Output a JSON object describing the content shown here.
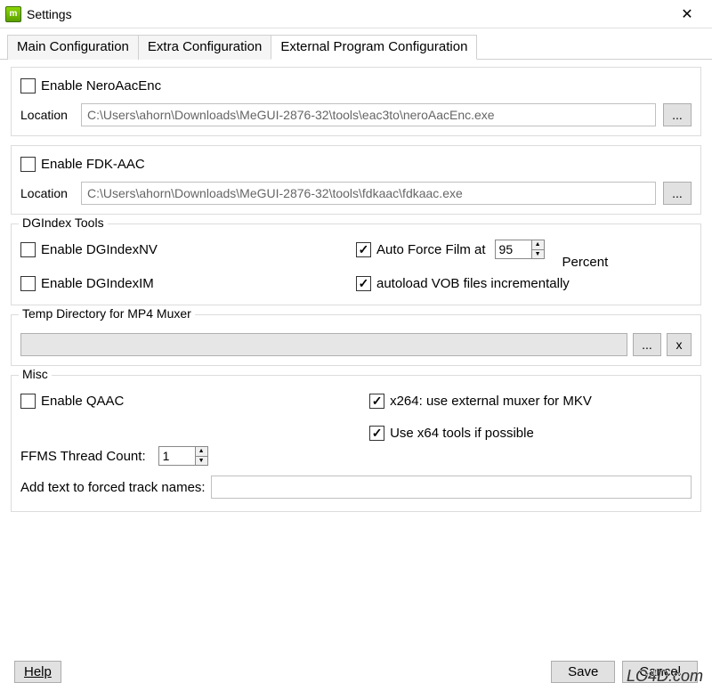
{
  "window": {
    "title": "Settings"
  },
  "tabs": {
    "main": "Main Configuration",
    "extra": "Extra Configuration",
    "external": "External Program Configuration"
  },
  "nero": {
    "enable_label": "Enable NeroAacEnc",
    "checked": false,
    "location_label": "Location",
    "path": "C:\\Users\\ahorn\\Downloads\\MeGUI-2876-32\\tools\\eac3to\\neroAacEnc.exe",
    "browse": "..."
  },
  "fdk": {
    "enable_label": "Enable FDK-AAC",
    "checked": false,
    "location_label": "Location",
    "path": "C:\\Users\\ahorn\\Downloads\\MeGUI-2876-32\\tools\\fdkaac\\fdkaac.exe",
    "browse": "..."
  },
  "dgindex": {
    "legend": "DGIndex Tools",
    "nv_label": "Enable DGIndexNV",
    "nv_checked": false,
    "im_label": "Enable DGIndexIM",
    "im_checked": false,
    "autoforce_label": "Auto Force Film at",
    "autoforce_checked": true,
    "autoforce_value": "95",
    "percent_label": "Percent",
    "autoload_label": "autoload VOB files incrementally",
    "autoload_checked": true
  },
  "tempdir": {
    "legend": "Temp Directory for MP4 Muxer",
    "value": "",
    "browse": "...",
    "clear": "x"
  },
  "misc": {
    "legend": "Misc",
    "qaac_label": "Enable QAAC",
    "qaac_checked": false,
    "x264_label": "x264: use external muxer for MKV",
    "x264_checked": true,
    "x64_label": "Use x64 tools if possible",
    "x64_checked": true,
    "ffms_label": "FFMS Thread Count:",
    "ffms_value": "1",
    "forced_label": "Add text to forced track names:",
    "forced_value": ""
  },
  "footer": {
    "help": "Help",
    "save": "Save",
    "cancel": "Cancel"
  },
  "watermark": "LO4D.com"
}
